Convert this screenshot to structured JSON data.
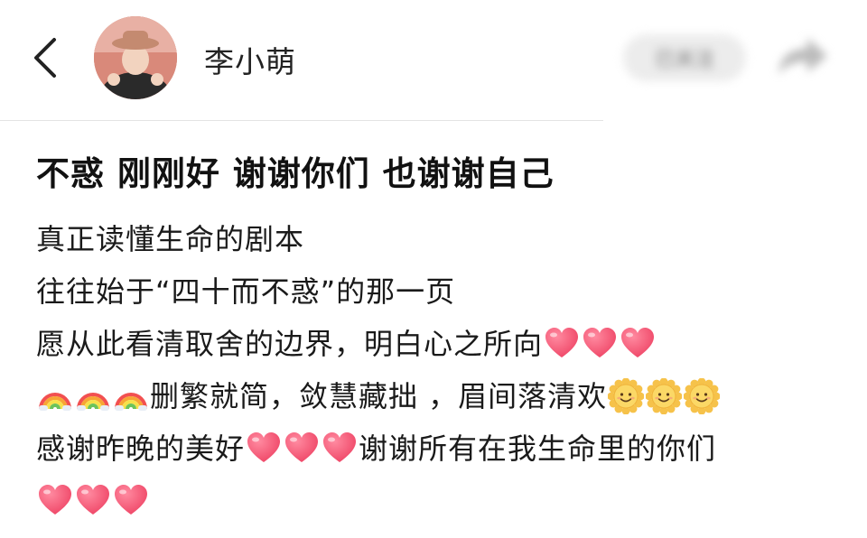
{
  "header": {
    "username": "李小萌",
    "follow_label": "已关注"
  },
  "post": {
    "title": "不惑 刚刚好 谢谢你们 也谢谢自己",
    "line1": "真正读懂生命的剧本",
    "line2": "往往始于“四十而不惑”的那一页",
    "line3": "愿从此看清取舍的边界，明白心之所向",
    "line4": "删繁就简，敛慧藏拙 ，眉间落清欢",
    "line5a": "感谢昨晚的美好",
    "line5b": "谢谢所有在我生命里的你们"
  },
  "icons": {
    "heart_color": "#f04a6a",
    "rainbow": "rainbow-emoji",
    "sun": "sun-smile-emoji",
    "heart": "red-heart-emoji"
  }
}
